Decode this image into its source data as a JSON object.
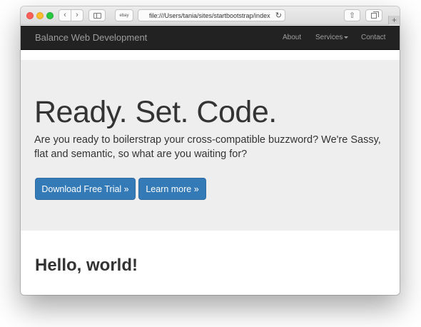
{
  "browser": {
    "nav_back": "‹",
    "nav_forward": "›",
    "favorite_label": "ebay",
    "url": "file:///Users/tania/sites/startbootstrap/index",
    "reload": "↻",
    "share": "⇧",
    "new_tab": "+"
  },
  "navbar": {
    "brand": "Balance Web Development",
    "links": [
      {
        "label": "About"
      },
      {
        "label": "Services"
      },
      {
        "label": "Contact"
      }
    ]
  },
  "hero": {
    "title": "Ready. Set. Code.",
    "lead": "Are you ready to boilerstrap your cross-compatible buzzword? We're Sassy, flat and semantic, so what are you waiting for?",
    "buttons": [
      {
        "label": "Download Free Trial »"
      },
      {
        "label": "Learn more »"
      }
    ]
  },
  "content": {
    "heading": "Hello, world!"
  },
  "colors": {
    "navbar_bg": "#222222",
    "navbar_text": "#9d9d9d",
    "jumbotron_bg": "#eeeeee",
    "primary_button": "#337ab7"
  }
}
